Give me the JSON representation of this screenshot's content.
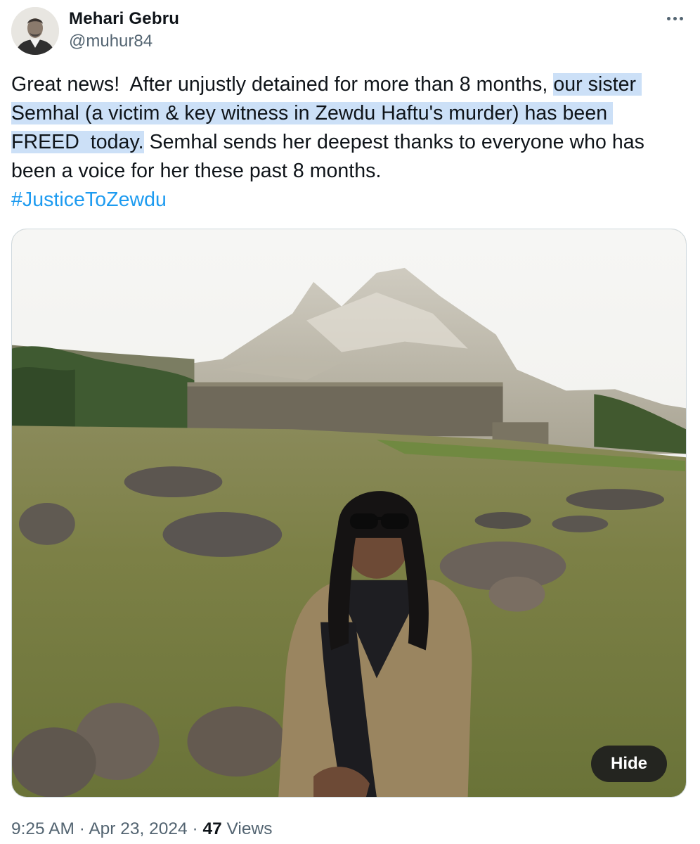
{
  "author": {
    "display_name": "Mehari Gebru",
    "handle": "@muhur84",
    "avatar_icon": "profile-photo"
  },
  "more_icon": "more-horizontal-icon",
  "tweet": {
    "lines": [
      {
        "plain": "Great news!  After unjustly detained for more than 8 months, ",
        "highlight": "our sister ",
        "rest": ""
      },
      {
        "plain": "",
        "highlight": "Semhal (a victim & key witness in Zewdu Haftu's murder) has been ",
        "rest": ""
      },
      {
        "plain": "",
        "highlight": "FREED  today.",
        "rest": " Semhal sends her deepest thanks to everyone who has"
      },
      {
        "plain": "been a voice for her these past 8 months.",
        "highlight": "",
        "rest": ""
      }
    ],
    "hashtag": "#JusticeToZewdu",
    "highlight_color": "#cce0f7",
    "link_color": "#1d9bf0"
  },
  "media": {
    "hide_label": "Hide"
  },
  "meta": {
    "time": "9:25 AM",
    "separator": "·",
    "date": "Apr 23, 2024",
    "views_count": "47",
    "views_label": "Views"
  }
}
